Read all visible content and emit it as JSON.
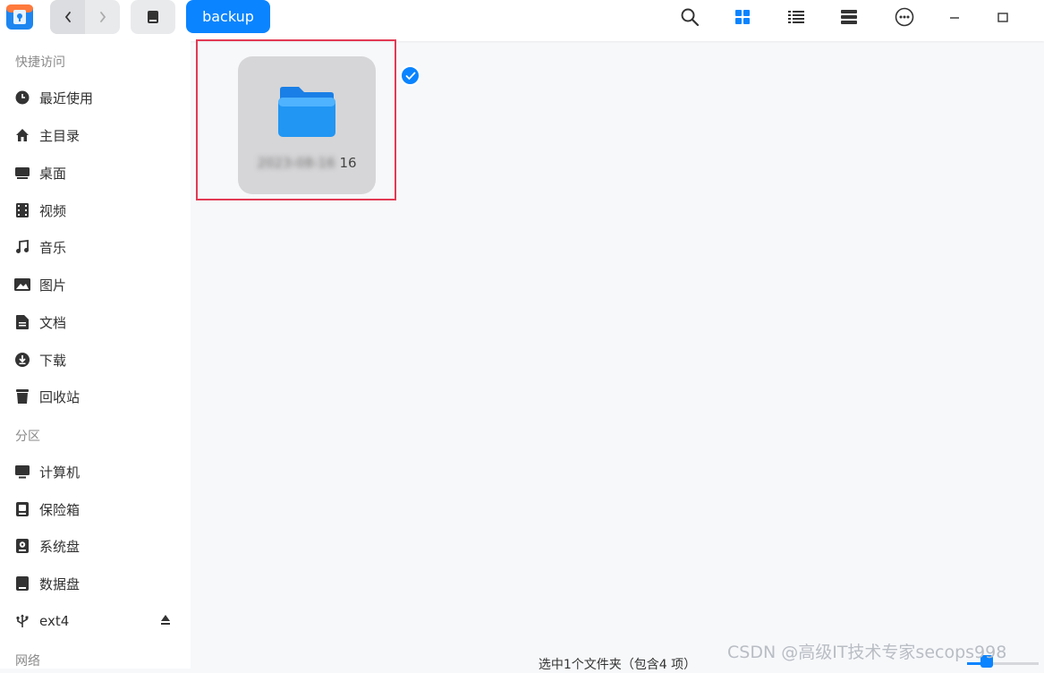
{
  "toolbar": {
    "breadcrumb_label": "backup",
    "icons": [
      "app-icon",
      "back-icon",
      "forward-icon",
      "disk-icon",
      "search-icon",
      "icon-view-icon",
      "list-view-icon",
      "tree-view-icon",
      "more-icon",
      "minimize-icon",
      "maximize-icon"
    ]
  },
  "sidebar": {
    "quick_access_title": "快捷访问",
    "quick_access": [
      {
        "label": "最近使用",
        "icon": "clock-icon"
      },
      {
        "label": "主目录",
        "icon": "home-icon"
      },
      {
        "label": "桌面",
        "icon": "desktop-icon"
      },
      {
        "label": "视频",
        "icon": "video-icon"
      },
      {
        "label": "音乐",
        "icon": "music-icon"
      },
      {
        "label": "图片",
        "icon": "picture-icon"
      },
      {
        "label": "文档",
        "icon": "document-icon"
      },
      {
        "label": "下载",
        "icon": "download-icon"
      },
      {
        "label": "回收站",
        "icon": "trash-icon"
      }
    ],
    "partitions_title": "分区",
    "partitions": [
      {
        "label": "计算机",
        "icon": "computer-icon"
      },
      {
        "label": "保险箱",
        "icon": "vault-icon"
      },
      {
        "label": "系统盘",
        "icon": "system-disk-icon"
      },
      {
        "label": "数据盘",
        "icon": "data-disk-icon"
      },
      {
        "label": "ext4",
        "icon": "usb-icon"
      }
    ],
    "network_title": "网络"
  },
  "main": {
    "folder": {
      "name_blurred": "2023-08-16",
      "name_visible": "16",
      "selected": true
    },
    "status_text": "选中1个文件夹（包含4 项）"
  },
  "watermark": "CSDN @高级IT技术专家secops998",
  "colors": {
    "accent": "#0a84ff",
    "selection_frame": "#e23a54",
    "tile_bg": "#d6d6d8"
  }
}
